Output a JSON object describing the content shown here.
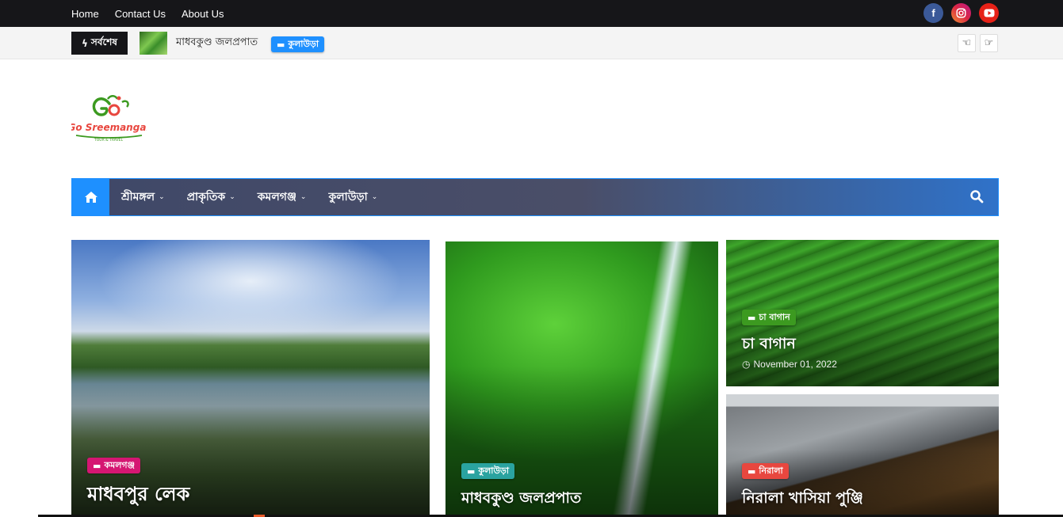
{
  "topbar": {
    "links": [
      "Home",
      "Contact Us",
      "About Us"
    ],
    "social": [
      {
        "icon": "facebook-icon",
        "glyph": "f"
      },
      {
        "icon": "instagram-icon",
        "glyph": "◎"
      },
      {
        "icon": "youtube-icon",
        "glyph": "▶"
      }
    ]
  },
  "ticker": {
    "label": "সর্বশেষ",
    "label_icon": "bolt-icon",
    "title": "মাধবকুণ্ড জলপ্রপাত",
    "badge": "কুলাউড়া",
    "prev_icon": "hand-left-icon",
    "next_icon": "hand-right-icon"
  },
  "logo": {
    "text": "Go Sreemangal",
    "tagline": "TOUR & TRAVEL"
  },
  "mainnav": {
    "items": [
      {
        "label": "শ্রীমঙ্গল"
      },
      {
        "label": "প্রাকৃতিক"
      },
      {
        "label": "কমলগঞ্জ"
      },
      {
        "label": "কুলাউড়া"
      }
    ]
  },
  "featured": [
    {
      "badge": "কমলগঞ্জ",
      "badge_color": "#d51672",
      "title": "মাধবপুর লেক"
    },
    {
      "badge": "কুলাউড়া",
      "badge_color": "#2aa3a0",
      "title": "মাধবকুণ্ড জলপ্রপাত"
    },
    {
      "badge": "চা বাগান",
      "badge_color": "#3c9a20",
      "title": "চা বাগান",
      "date": "November 01, 2022"
    },
    {
      "badge": "নিরালা",
      "badge_color": "#e8473f",
      "title": "নিরালা খাসিয়া পুঞ্জি"
    }
  ],
  "colors": {
    "accent": "#1e90ff",
    "topbar_bg": "#161619"
  }
}
